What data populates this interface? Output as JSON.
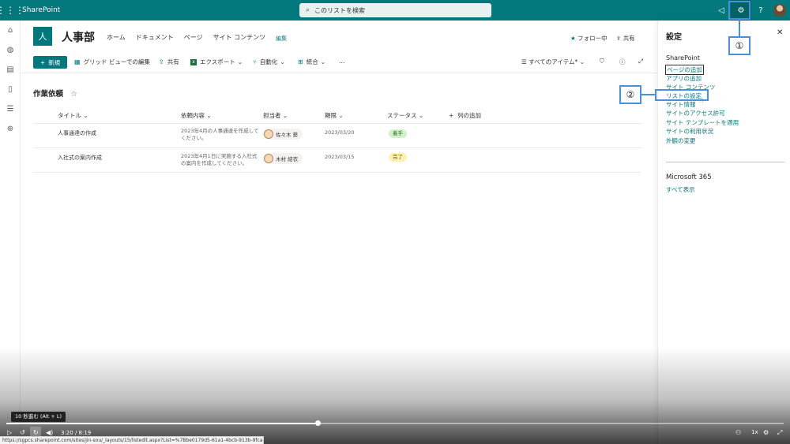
{
  "suite_bar": {
    "brand": "SharePoint",
    "search_placeholder": "このリストを検索",
    "help": "?"
  },
  "site": {
    "logo_letter": "人",
    "title": "人事部",
    "nav": [
      "ホーム",
      "ドキュメント",
      "ページ",
      "サイト コンテンツ"
    ],
    "edit_label": "編集",
    "follow_label": "フォロー中",
    "share_label": "共有"
  },
  "command_bar": {
    "new_label": "新規",
    "grid_edit_label": "グリッド ビューでの編集",
    "share_label": "共有",
    "export_label": "エクスポート",
    "automate_label": "自動化",
    "integrate_label": "統合",
    "more_label": "…",
    "view_label": "すべてのアイテム*"
  },
  "list": {
    "title": "作業依頼",
    "columns": [
      "タイトル",
      "依頼内容",
      "担当者",
      "期限",
      "ステータス",
      "列の追加"
    ],
    "rows": [
      {
        "title": "人事通達の作成",
        "content_line1": "2023年4月の人事通達を作成して",
        "content_line2": "ください。",
        "assignee": "佐々木 葵",
        "due": "2023/03/20",
        "status": "着手",
        "status_color": "#d2f2c9"
      },
      {
        "title": "入社式の案内作成",
        "content_line1": "2023年4月1日に実施する入社式",
        "content_line2": "の案内を作成してください。",
        "assignee": "木村 結衣",
        "due": "2023/03/15",
        "status": "完了",
        "status_color": "#fff1b3"
      }
    ]
  },
  "settings_panel": {
    "title": "設定",
    "sharepoint_heading": "SharePoint",
    "links": [
      "ページの追加",
      "アプリの追加",
      "サイト コンテンツ",
      "リストの設定",
      "サイト情報",
      "サイトのアクセス許可",
      "サイト テンプレートを適用",
      "サイトの利用状況",
      "外観の変更"
    ],
    "m365_heading": "Microsoft 365",
    "m365_link": "すべて表示"
  },
  "callouts": {
    "one": "①",
    "two": "②"
  },
  "video_player": {
    "tooltip": "10 秒進む (Alt + L)",
    "time": "3:20 / 8:19",
    "progress": 0.4,
    "speed": "1x"
  },
  "status_url": "https://sgpcs.sharepoint.com/sites/jin-sou/_layouts/15/listedit.aspx?List=%7Bbe0179d5-61a1-4bcb-913b-9fca8fb5a7...",
  "colors": {
    "accent": "#03787c",
    "callout_border": "#4a90d9"
  }
}
